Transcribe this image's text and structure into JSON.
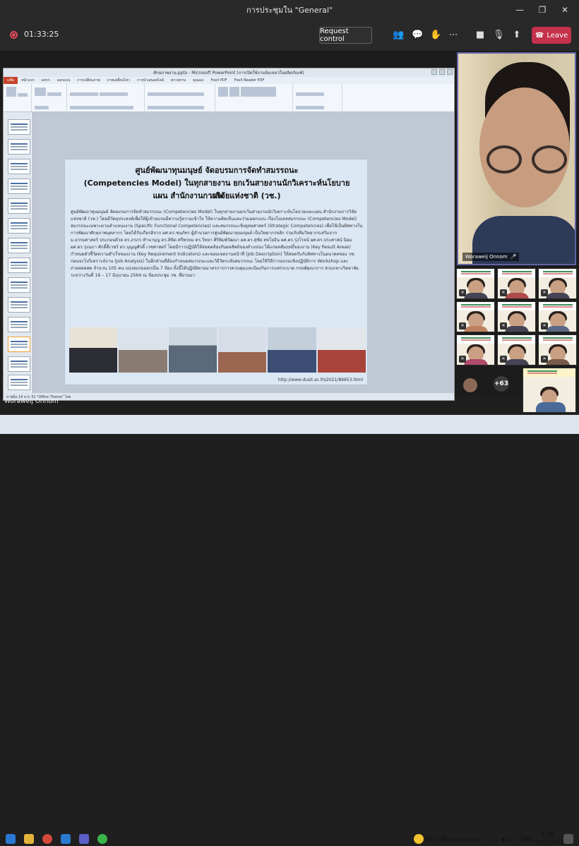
{
  "window": {
    "title": "การประชุมใน \"General\"",
    "minimize": "—",
    "restore": "❐",
    "close": "✕"
  },
  "meeting": {
    "timer": "01:33:25",
    "request_control": "Request control",
    "leave": "Leave"
  },
  "ppt": {
    "title": "ศักยภาพงาน.pptx - Microsoft PowerPoint (การเปิดใช้งานล้มเหลวในผลิตภัณฑ์)",
    "tabs": [
      "หน้าแรก",
      "แทรก",
      "ออกแบบ",
      "การเปลี่ยนภาพ",
      "ภาพเคลื่อนไหว",
      "การนำเสนอสไลด์",
      "ตรวจทาน",
      "มุมมอง",
      "Foxit PDF",
      "Foxit Reader PDF"
    ],
    "file_tab": "แฟ้ม",
    "status": "ภาพนิ่ง 14 จาก 31   \"Office Theme\"   ไทย"
  },
  "slide": {
    "heading1": "ศูนย์พัฒนาทุนมนุษย์ จัดอบรมการจัดทำสมรรถนะ",
    "heading2": "(Competencies Model) ในทุกสายงาน ยกเว้นสายงานนักวิเคราะห์นโยบายและ",
    "heading3": "แผน สำนักงานการวิจัยแห่งชาติ (วช.)",
    "body": "ศูนย์พัฒนาทุนมนุษย์ จัดอบรมการจัดทำสมรรถนะ (Competencies Model) ในทุกสายงานยกเว้นสายงานนักวิเคราะห์นโยบายและแผน สำนักงานการวิจัยแห่งชาติ (วช.) โดยมีวัตถุประสงค์เพื่อให้ผู้เข้าอบรมมีความรู้ความเข้าใจ ให้ความคิดเห็นและร่วมออกแบบ เรื่องโมเดลสมรรถนะ (Competencies Model) สมรรถนะเฉพาะตามตำแหน่งงาน (Specific Functional Competencies) และสมรรถนะเชิงยุทธศาสตร์ (Strategic Competencies) เพื่อใช้เป็นทิศทางในการพัฒนาศักยภาพบุคลากร โดยได้รับเกียรติจาก ผศ.ดร.ชนภัทร ผู้อำนวยการศูนย์พัฒนาทุนมนุษย์ เป็นวิทยากรหลัก ร่วมกับทีมวิทยากรเสริมจาก ม.ธรรมศาสตร์ ประกอบด้วย ดร.ภรภร ทำนาบุญ ดร.ลิขิต ศรีพรหม ดร.วิทยา ศิริพิมพ์วัฒนา ผศ.ดร.สุชัย สหโยธิน ผศ.ดร.รุ่งโรจน์ ผศ.ดร.ประศาสน์ นิยม ผศ.ดร.รุ่งนภา ศักดิ์ดีเวชร์ ดร.บุญญศักดิ์ เวชศาสตร์ โดยมีการปฏิบัติให้สอดคล้องกับผลลัพธ์ของตำแหน่ง ได้แก่ผลสัมฤทธิ์ของงาน (Key Result Areas) กำหนดตัวชี้วัดความสำเร็จของงาน (Key Requirement Indicators) และขอบเขตงานหน้าที่ (Job Description) ให้สอดรับกับทิศทางในอนาคตของ วช. ก่อนจะไปวิเคราะห์งาน (Job Analysis) ในอีกส่วนที่ต้องกำหนดสมรรถนะและวิธีวัดระดับสมรรถนะ โดยใช้วิธีการอบรมเชิงปฏิบัติการ Workshop และถ่ายทอดสด จำนวน 105 คน แบ่งอบรมออกเป็น 7 ห้อง ทั้งนี้ได้ปฏิบัติตามมาตรการการควบคุมและป้องกันการแพร่ระบาด กรมพัฒนาการ สวนกลางวิทยาลัย ระหว่างวันที่ 16 – 17 มิถุนายน 2564 ณ ห้องประชุม วช. ที่ผ่านมา",
    "url": "http://www.dusit.ac.th/2021/89653.html"
  },
  "presenter": {
    "name": "Woraweij Onnom"
  },
  "main_video": {
    "name": "Woraweij Onnom"
  },
  "participants": {
    "more": "+63"
  },
  "taskbar": {
    "weather": "30°C  Mostly sunny",
    "lang": "ENG",
    "time": "9:38",
    "date": "2/11/2564"
  }
}
